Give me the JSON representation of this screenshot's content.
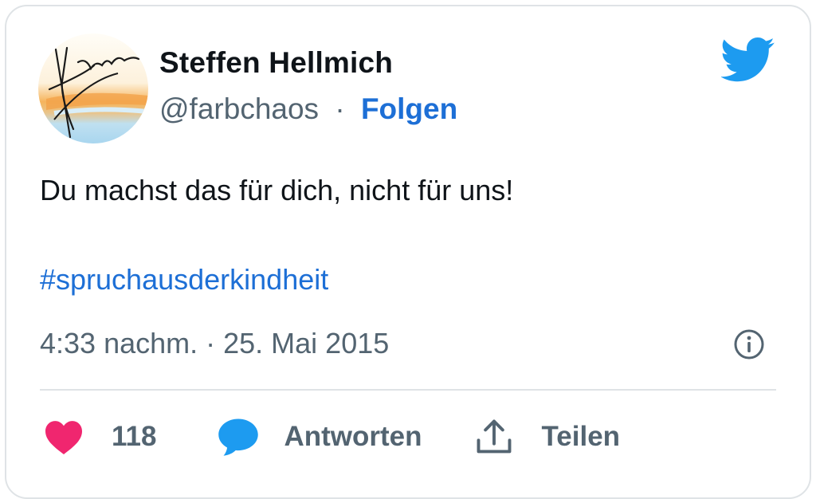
{
  "author": {
    "name": "Steffen Hellmich",
    "handle": "@farbchaos",
    "separator": "·",
    "follow_label": "Folgen"
  },
  "tweet": {
    "text": "Du machst das für dich, nicht für uns!",
    "hashtag": "#spruchausderkindheit",
    "timestamp": "4:33 nachm. · 25. Mai 2015"
  },
  "actions": {
    "like_count": "118",
    "reply_label": "Antworten",
    "share_label": "Teilen"
  },
  "colors": {
    "accent": "#1d6fd6",
    "twitter_blue": "#1d9bf0",
    "like_pink": "#f0266f",
    "secondary_text": "#536471"
  },
  "icons": [
    "avatar",
    "twitter-bird-icon",
    "info-icon",
    "heart-icon",
    "reply-bubble-icon",
    "share-icon"
  ]
}
